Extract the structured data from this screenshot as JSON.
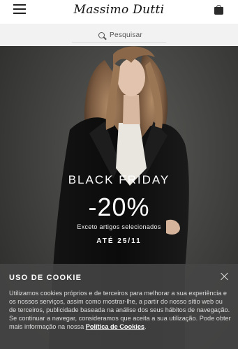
{
  "header": {
    "logo": "Massimo Dutti",
    "menu_icon": "hamburger-menu-icon",
    "bag_icon": "shopping-bag-icon"
  },
  "search": {
    "label": "Pesquisar",
    "icon": "search-icon"
  },
  "promo": {
    "title": "BLACK FRIDAY",
    "discount": "-20%",
    "note": "Exceto artigos selecionados",
    "date": "ATÉ 25/11"
  },
  "cookie": {
    "title": "USO DE COOKIE",
    "text": "Utilizamos cookies próprios e de terceiros para melhorar a sua experiência e os nossos serviços, assim como mostrar-lhe, a partir do nosso sítio web ou de terceiros, publicidade baseada na análise dos seus hábitos de navegação. Se continuar a navegar, consideramos que aceita a sua utilização. Pode obter mais informação na nossa ",
    "link": "Política de Cookies",
    "end": ".",
    "close_icon": "close-icon"
  }
}
